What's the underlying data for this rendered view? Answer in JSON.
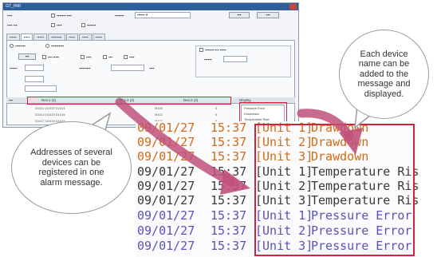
{
  "callouts": {
    "left": "Addresses of several devices can be registered in one alarm message.",
    "right": "Each device name can be added to the message and displayed."
  },
  "display_rows": [
    {
      "date": "09/01/27",
      "time": "15:37",
      "unit": "[Unit 1]",
      "message": "Drawdown",
      "color": "orange"
    },
    {
      "date": "09/01/27",
      "time": "15:37",
      "unit": "[Unit 2]",
      "message": "Drawdown",
      "color": "orange"
    },
    {
      "date": "09/01/27",
      "time": "15:37",
      "unit": "[Unit 3]",
      "message": "Drawdown",
      "color": "orange"
    },
    {
      "date": "09/01/27",
      "time": "15:37",
      "unit": "[Unit 1]",
      "message": "Temperature Rise",
      "color": "dark"
    },
    {
      "date": "09/01/27",
      "time": "15:37",
      "unit": "[Unit 2]",
      "message": "Temperature Rise",
      "color": "dark"
    },
    {
      "date": "09/01/27",
      "time": "15:37",
      "unit": "[Unit 3]",
      "message": "Temperature Rise",
      "color": "dark"
    },
    {
      "date": "09/01/27",
      "time": "15:37",
      "unit": "[Unit 1]",
      "message": "Pressure Error",
      "color": "violet"
    },
    {
      "date": "09/01/27",
      "time": "15:37",
      "unit": "[Unit 2]",
      "message": "Pressure Error",
      "color": "violet"
    },
    {
      "date": "09/01/27",
      "time": "15:37",
      "unit": "[Unit 3]",
      "message": "Pressure Error",
      "color": "violet"
    }
  ],
  "window": {
    "title": "GT_HMI",
    "table_headers": {
      "device1": "Dev.1 (1)",
      "device2": "Dev.2 (2)",
      "device3": "Dev.3 (3)",
      "display": "Display"
    },
    "rows": [
      {
        "a": "D1011 D1012 D1013",
        "b": "M100",
        "c": "0"
      },
      {
        "a": "D1014 D1015 D1016",
        "b": "M101",
        "c": "0"
      },
      {
        "a": "D1017 D1018 D1019",
        "b": "M102",
        "c": "0"
      }
    ],
    "selected_items": [
      "Pressure Error",
      "Drawdown",
      "Temperature Rise"
    ]
  },
  "colors": {
    "highlight": "#d2233c",
    "arrow": "#c0517a"
  }
}
